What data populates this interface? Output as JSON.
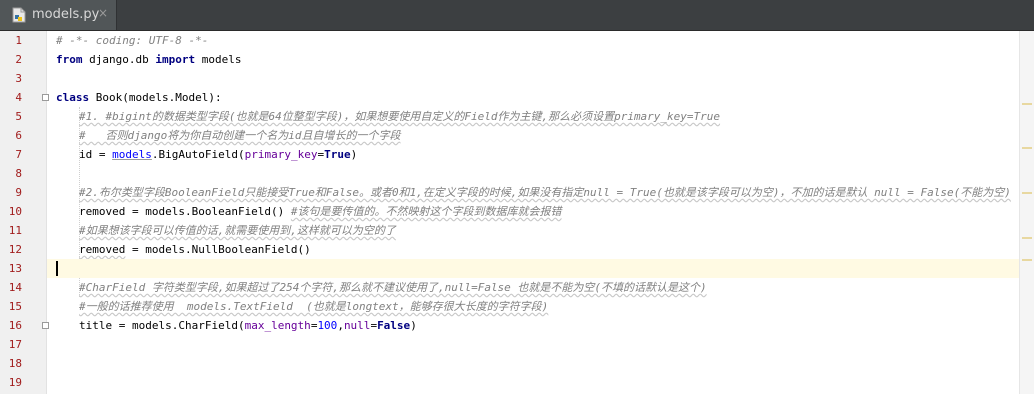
{
  "tab": {
    "title": "models.py",
    "close_glyph": "×",
    "icon": "python-file-icon"
  },
  "lines": [
    "1",
    "2",
    "3",
    "4",
    "5",
    "6",
    "7",
    "8",
    "9",
    "10",
    "11",
    "12",
    "13",
    "14",
    "15",
    "16",
    "17",
    "18",
    "19"
  ],
  "code": {
    "l1": "# -*- coding: UTF-8 -*-",
    "l2_from": "from",
    "l2_mod": " django.db ",
    "l2_import": "import",
    "l2_rest": " models",
    "l4_class": "class",
    "l4_rest": " Book(models.Model):",
    "l5": "#1. #bigint的数据类型字段(也就是64位整型字段)，如果想要使用自定义的Field作为主键,那么必须设置primary_key=True",
    "l6": "#   否则django将为你自动创建一个名为id且自增长的一个字段",
    "l7_a": "id = ",
    "l7_models": "models",
    "l7_b": ".BigAutoField(",
    "l7_kw": "primary_key",
    "l7_eq": "=",
    "l7_true": "True",
    "l7_c": ")",
    "l9": "#2.布尔类型字段BooleanField只能接受True和False。或者0和1,在定义字段的时候,如果没有指定null = True(也就是该字段可以为空)，不加的话是默认 null = False(不能为空)",
    "l10_a": "removed = models.BooleanField() ",
    "l10_cm": "#该句是要传值的。不然映射这个字段到数据库就会报错",
    "l11": "#如果想该字段可以传值的话,就需要使用到,这样就可以为空的了",
    "l12_a": "removed",
    "l12_b": " = models.NullBooleanField()",
    "l14": "#CharField 字符类型字段,如果超过了254个字符,那么就不建议使用了,null=False 也就是不能为空(不填的话默认是这个)",
    "l15": "#一般的话推荐使用  models.TextField  (也就是longtext，能够存很大长度的字符字段)",
    "l16_a": "title = models.CharField(",
    "l16_k1": "max_length",
    "l16_eq1": "=",
    "l16_n": "100",
    "l16_comma": ",",
    "l16_k2": "null",
    "l16_eq2": "=",
    "l16_false": "False",
    "l16_c": ")"
  },
  "colors": {
    "keyword": "#000080",
    "comment": "#808080",
    "line_number": "#a11c1c",
    "current_line": "#fffae3"
  }
}
